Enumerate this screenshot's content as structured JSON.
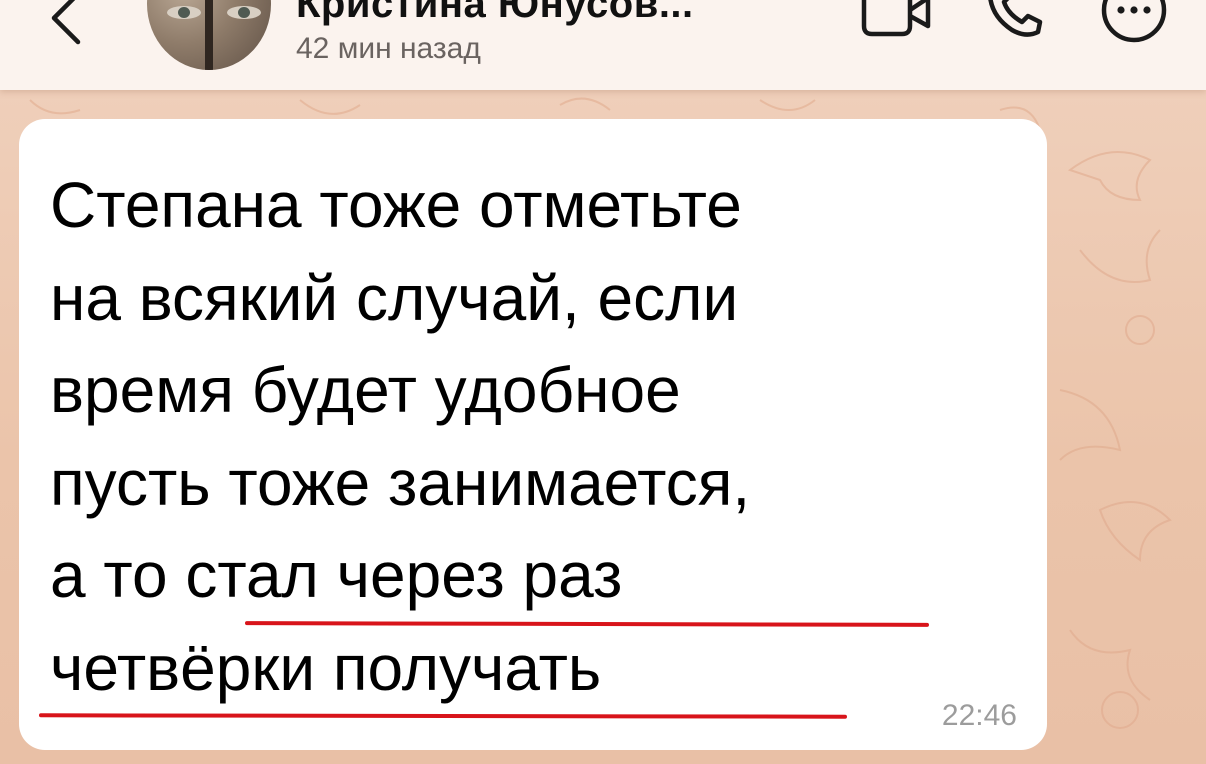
{
  "header": {
    "contact_name": "Кристина Юнусов...",
    "last_seen": "42 мин назад"
  },
  "message": {
    "lines": [
      "Степана тоже отметьте",
      "на всякий случай, если",
      "время будет удобное",
      "пусть тоже занимается,",
      "а то стал через раз",
      "четвёрки получать"
    ],
    "time": "22:46"
  },
  "icons": {
    "back": "chevron-left-icon",
    "video": "video-camera-icon",
    "call": "phone-icon",
    "more": "more-dots-icon"
  },
  "colors": {
    "header_bg": "#fbf3ee",
    "wallpaper": "#ecc7ae",
    "bubble": "#ffffff",
    "underline": "#d8141a",
    "time": "#9c9c9c"
  }
}
